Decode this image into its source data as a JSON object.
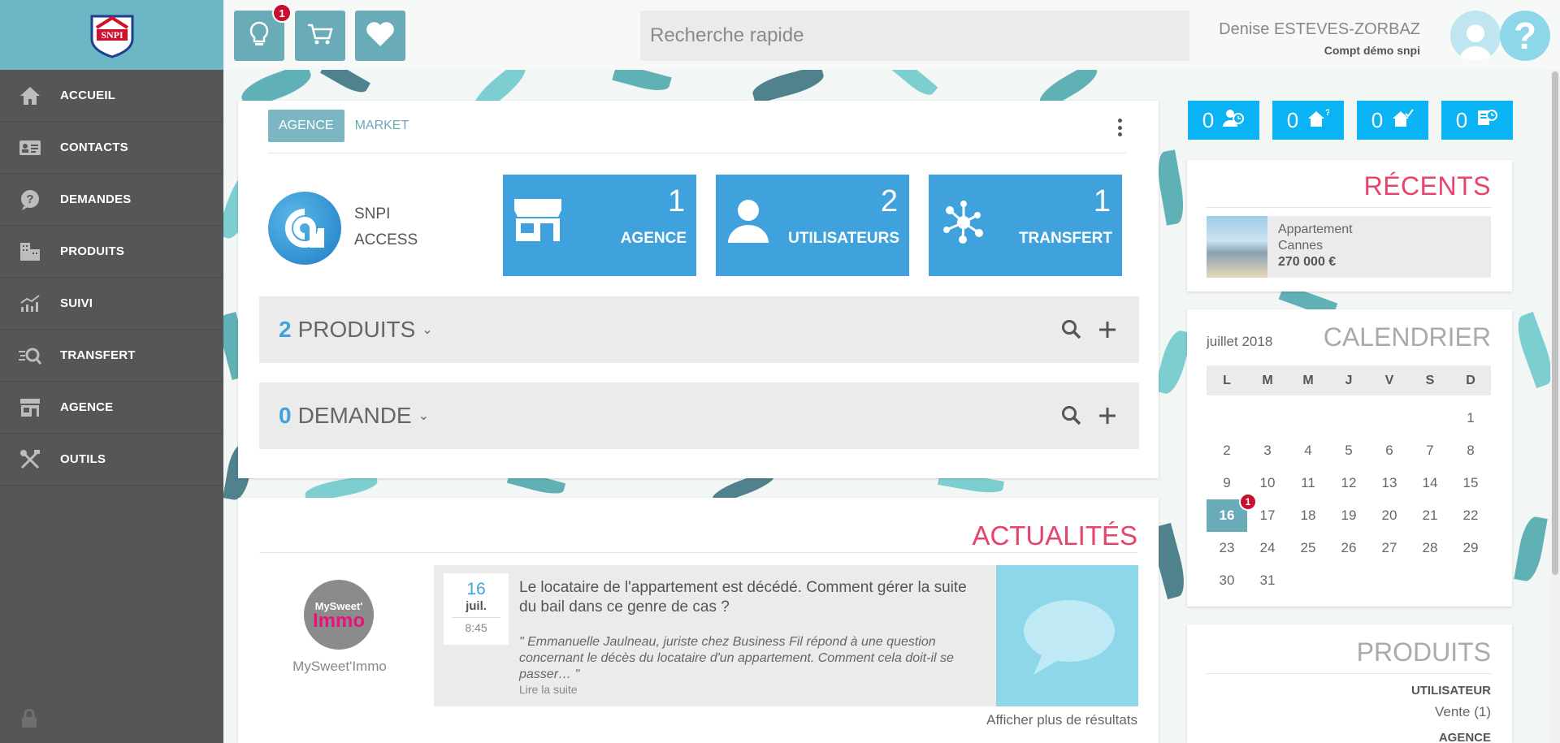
{
  "brand": {
    "logo_text": "SNPI"
  },
  "sidebar": {
    "items": [
      {
        "label": "ACCUEIL",
        "icon": "home-icon"
      },
      {
        "label": "CONTACTS",
        "icon": "contacts-card-icon"
      },
      {
        "label": "DEMANDES",
        "icon": "question-bubble-icon"
      },
      {
        "label": "PRODUITS",
        "icon": "buildings-icon"
      },
      {
        "label": "SUIVI",
        "icon": "chart-trend-icon"
      },
      {
        "label": "TRANSFERT",
        "icon": "transfer-search-icon"
      },
      {
        "label": "AGENCE",
        "icon": "store-icon"
      },
      {
        "label": "OUTILS",
        "icon": "tools-icon"
      }
    ]
  },
  "topbar": {
    "idea_badge": "1",
    "search_placeholder": "Recherche rapide",
    "user_name": "Denise ESTEVES-ZORBAZ",
    "user_company": "Compt démo snpi",
    "help_label": "?"
  },
  "main": {
    "tabs": [
      "AGENCE",
      "MARKET"
    ],
    "access_line1": "SNPI",
    "access_line2": "ACCESS",
    "tiles": [
      {
        "num": "1",
        "label": "AGENCE"
      },
      {
        "num": "2",
        "label": "UTILISATEURS"
      },
      {
        "num": "1",
        "label": "TRANSFERT"
      }
    ],
    "produits": {
      "count": "2",
      "label": "PRODUITS"
    },
    "demande": {
      "count": "0",
      "label": "DEMANDE"
    }
  },
  "news": {
    "title": "ACTUALITÉS",
    "brand_logo_top": "MySweet'",
    "brand_logo_bottom": "Immo",
    "brand_name": "MySweet'Immo",
    "date_day": "16",
    "date_month": "juil.",
    "date_time": "8:45",
    "headline": "Le locataire de l'appartement est décédé. Comment gérer la suite du bail dans ce genre de cas ?",
    "excerpt": "\" Emmanuelle Jaulneau, juriste chez Business Fil répond à une question concernant le décès du locataire d'un appartement. Comment cela doit-il se passer…  \"",
    "read_more": "Lire la suite",
    "show_more": "Afficher plus de résultats"
  },
  "stats": [
    "0",
    "0",
    "0",
    "0"
  ],
  "recent": {
    "title": "RÉCENTS",
    "item": {
      "type": "Appartement",
      "city": "Cannes",
      "price": "270 000 €"
    }
  },
  "calendar": {
    "month": "juillet 2018",
    "title": "CALENDRIER",
    "days": [
      "L",
      "M",
      "M",
      "J",
      "V",
      "S",
      "D"
    ],
    "cells": [
      "",
      "",
      "",
      "",
      "",
      "",
      "1",
      "2",
      "3",
      "4",
      "5",
      "6",
      "7",
      "8",
      "9",
      "10",
      "11",
      "12",
      "13",
      "14",
      "15",
      "16",
      "17",
      "18",
      "19",
      "20",
      "21",
      "22",
      "23",
      "24",
      "25",
      "26",
      "27",
      "28",
      "29",
      "30",
      "31"
    ],
    "today": "16",
    "today_badge": "1"
  },
  "products_panel": {
    "title": "PRODUITS",
    "user_label": "UTILISATEUR",
    "vente": "Vente (1)",
    "agence_label": "AGENCE"
  },
  "colors": {
    "teal": "#6aabb8",
    "blue": "#3fa2dd",
    "cyan": "#0ab3f3",
    "pink": "#e8436b",
    "sidebar": "#555657"
  }
}
